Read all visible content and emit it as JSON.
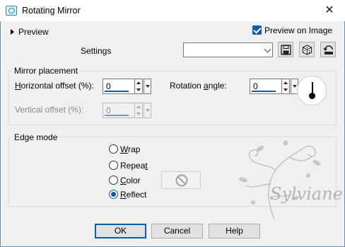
{
  "window": {
    "title": "Rotating Mirror",
    "close_glyph": "✕",
    "icon": "rotating-mirror-app-icon"
  },
  "top": {
    "preview_toggle_label": "Preview",
    "preview_on_image": {
      "label": "Preview on Image",
      "checked": true
    },
    "settings_label": "Settings",
    "settings_value": "",
    "toolbar_icons": [
      "save-preset-icon",
      "randomize-icon",
      "reset-icon"
    ]
  },
  "mirror_placement": {
    "title": "Mirror placement",
    "horizontal_offset": {
      "prefix": "",
      "underlined": "H",
      "suffix": "orizontal offset (%):",
      "value": "0"
    },
    "vertical_offset": {
      "label": "Vertical offset (%):",
      "value": "0",
      "enabled": false
    },
    "rotation_angle": {
      "prefix": "Rotation ",
      "underlined": "a",
      "suffix": "ngle:",
      "value": "0"
    }
  },
  "edge_mode": {
    "title": "Edge mode",
    "options": [
      {
        "pre": "",
        "ul": "W",
        "post": "rap",
        "selected": false
      },
      {
        "pre": "Repea",
        "ul": "t",
        "post": "",
        "selected": false
      },
      {
        "pre": "",
        "ul": "C",
        "post": "olor",
        "selected": false
      },
      {
        "pre": "",
        "ul": "R",
        "post": "eflect",
        "selected": true
      }
    ]
  },
  "buttons": {
    "ok": "OK",
    "cancel": "Cancel",
    "help": "Help"
  },
  "watermark": {
    "text": "Sylviane"
  },
  "colors": {
    "accent": "#0b5cad",
    "group_border": "#dcdcdc",
    "background": "#f0f0f0"
  }
}
